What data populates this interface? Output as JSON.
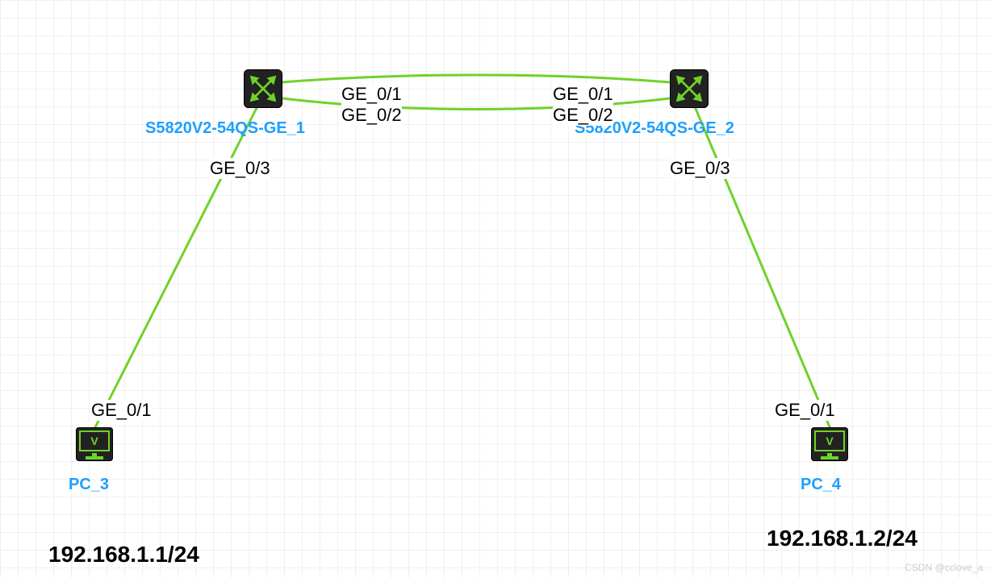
{
  "nodes": {
    "switch1": {
      "label": "S5820V2-54QS-GE_1",
      "ports": {
        "p1": "GE_0/1",
        "p2": "GE_0/2",
        "p3": "GE_0/3"
      }
    },
    "switch2": {
      "label": "S5820V2-54QS-GE_2",
      "ports": {
        "p1": "GE_0/1",
        "p2": "GE_0/2",
        "p3": "GE_0/3"
      }
    },
    "pc3": {
      "label": "PC_3",
      "ip": "192.168.1.1/24",
      "ports": {
        "p1": "GE_0/1"
      }
    },
    "pc4": {
      "label": "PC_4",
      "ip": "192.168.1.2/24",
      "ports": {
        "p1": "GE_0/1"
      }
    }
  },
  "watermark": "CSDN @cclove_a",
  "colors": {
    "link": "#6fd22a",
    "label": "#1e9fff"
  },
  "icon_letter": "V"
}
